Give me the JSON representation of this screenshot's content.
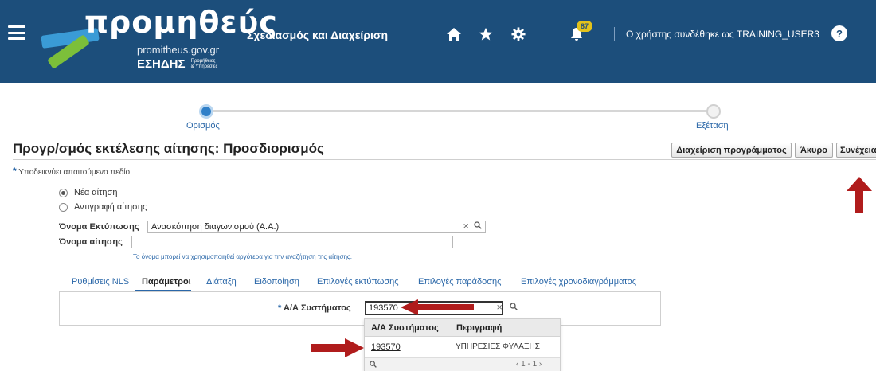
{
  "header": {
    "logo_word": "προμηθεύς",
    "logo_url": "promitheus.gov.gr",
    "logo_esidis": "ΕΣΗΔΗΣ",
    "logo_small_line1": "Προμήθειες",
    "logo_small_line2": "& Υπηρεσίες",
    "app_title": "Σχεδιασμός και Διαχείριση",
    "notification_count": "87",
    "logged_in_text": "Ο χρήστης συνδέθηκε ως TRAINING_USER3",
    "help_symbol": "?",
    "colors": {
      "header_bg": "#1c4e7b",
      "badge": "#e2c21b"
    },
    "icons": [
      "menu-icon",
      "home-icon",
      "star-icon",
      "gear-icon",
      "bell-icon",
      "help-icon"
    ]
  },
  "train": {
    "steps": [
      {
        "label": "Ορισμός",
        "active": true
      },
      {
        "label": "Εξέταση",
        "active": false
      }
    ]
  },
  "page": {
    "title": "Προγρ/σμός εκτέλεσης αίτησης: Προσδιορισμός",
    "required_note": "Υποδεικνύει απαιτούμενο πεδίο",
    "required_star": "*"
  },
  "buttons": {
    "manage_schedule": "Διαχείριση προγράμματος",
    "cancel": "Άκυρο",
    "continue": "Συνέχεια"
  },
  "request_options": [
    {
      "label": "Νέα αίτηση",
      "selected": true
    },
    {
      "label": "Αντιγραφή αίτησης",
      "selected": false
    }
  ],
  "form": {
    "print_name_label": "Όνομα Εκτύπωσης",
    "print_name_value": "Ανασκόπηση διαγωνισμού (Α.Α.)",
    "request_name_label": "Όνομα αίτησης",
    "request_name_value": "",
    "request_name_hint": "Το όνομα μπορεί να χρησιμοποιηθεί αργότερα για την αναζήτηση της αίτησης."
  },
  "tabs": [
    {
      "label": "Ρυθμίσεις NLS",
      "active": false
    },
    {
      "label": "Παράμετροι",
      "active": true
    },
    {
      "label": "Διάταξη",
      "active": false
    },
    {
      "label": "Ειδοποίηση",
      "active": false
    },
    {
      "label": "Επιλογές εκτύπωσης",
      "active": false
    },
    {
      "label": "Επιλογές παράδοσης",
      "active": false
    },
    {
      "label": "Επιλογές χρονοδιαγράμματος",
      "active": false
    }
  ],
  "parameters": {
    "system_id_label": "Α/Α Συστήματος",
    "system_id_value": "193570"
  },
  "lov": {
    "col_id": "Α/Α Συστήματος",
    "col_desc": "Περιγραφή",
    "rows": [
      {
        "id": "193570",
        "desc": "ΥΠΗΡΕΣΙΕΣ ΦΥΛΑΞΗΣ"
      }
    ],
    "pages": "1 - 1"
  },
  "annotations": {
    "arrow_color": "#b01c1c"
  }
}
